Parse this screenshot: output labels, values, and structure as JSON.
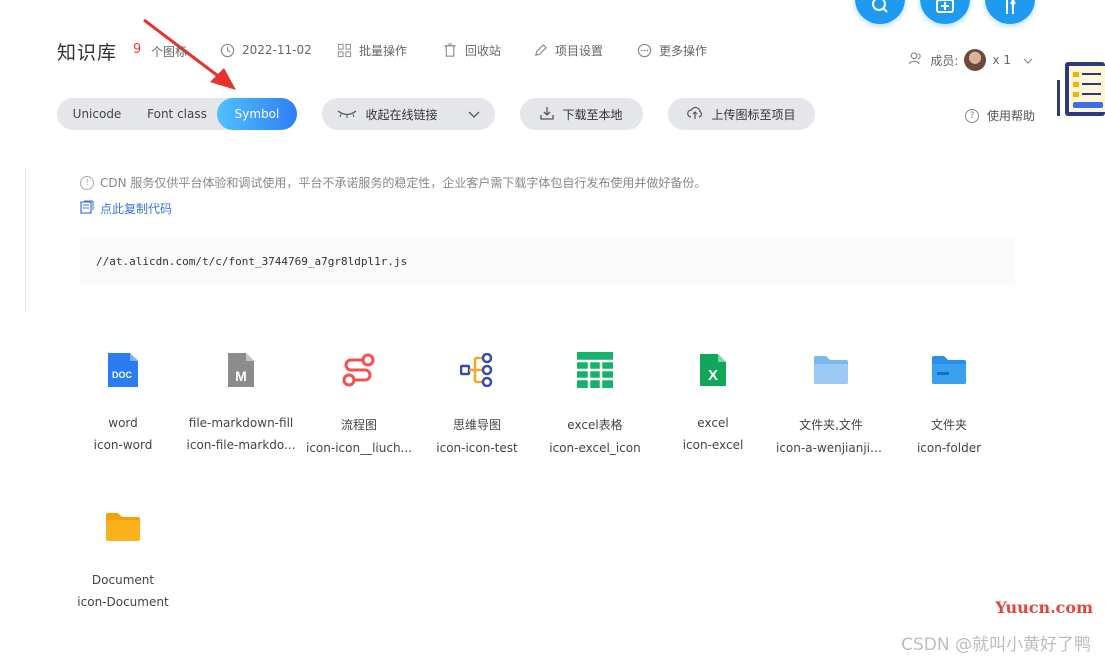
{
  "header": {
    "title": "知识库",
    "icon_count": "9",
    "icon_count_suffix": "个图标",
    "date": "2022-11-02",
    "batch_ops": "批量操作",
    "recycle": "回收站",
    "project_settings": "项目设置",
    "more_ops": "更多操作",
    "members_label": "成员:",
    "members_count": "x 1"
  },
  "toolbar": {
    "tabs": [
      {
        "label": "Unicode",
        "active": false
      },
      {
        "label": "Font class",
        "active": false
      },
      {
        "label": "Symbol",
        "active": true
      }
    ],
    "collapse_link": "收起在线链接",
    "download": "下载至本地",
    "upload": "上传图标至项目",
    "help": "使用帮助"
  },
  "cdn": {
    "notice": "CDN 服务仅供平台体验和调试使用，平台不承诺服务的稳定性，企业客户需下载字体包自行发布使用并做好备份。",
    "copy_code": "点此复制代码",
    "url": "//at.alicdn.com/t/c/font_3744769_a7gr8ldpl1r.js"
  },
  "icons": [
    {
      "name": "word",
      "code": "icon-word",
      "icon": "doc-icon",
      "color": "#2b7bf3"
    },
    {
      "name": "file-markdown-fill",
      "code": "icon-file-markdo...",
      "icon": "markdown-file-icon",
      "color": "#8c8c8c"
    },
    {
      "name": "流程图",
      "code": "icon-icon__liuch...",
      "icon": "flowchart-icon",
      "color": "#ef5350"
    },
    {
      "name": "思维导图",
      "code": "icon-icon-test",
      "icon": "mindmap-icon",
      "color": "#3a4aa8"
    },
    {
      "name": "excel表格",
      "code": "icon-excel_icon",
      "icon": "excel-table-icon",
      "color": "#16b26b"
    },
    {
      "name": "excel",
      "code": "icon-excel",
      "icon": "excel-icon",
      "color": "#12a65a"
    },
    {
      "name": "文件夹,文件",
      "code": "icon-a-wenjianjia...",
      "icon": "folder-light-icon",
      "color": "#7db7f2"
    },
    {
      "name": "文件夹",
      "code": "icon-folder",
      "icon": "folder-icon",
      "color": "#3aa0f0"
    },
    {
      "name": "Document",
      "code": "icon-Document",
      "icon": "document-folder-icon",
      "color": "#f9b21c"
    }
  ],
  "watermarks": {
    "site": "Yuucn.com",
    "csdn": "CSDN @就叫小黄好了鸭"
  },
  "colors": {
    "accent": "#2f7ef5",
    "count": "#e03b3b",
    "link": "#3b74e0",
    "annotation_arrow": "#e8322d"
  }
}
